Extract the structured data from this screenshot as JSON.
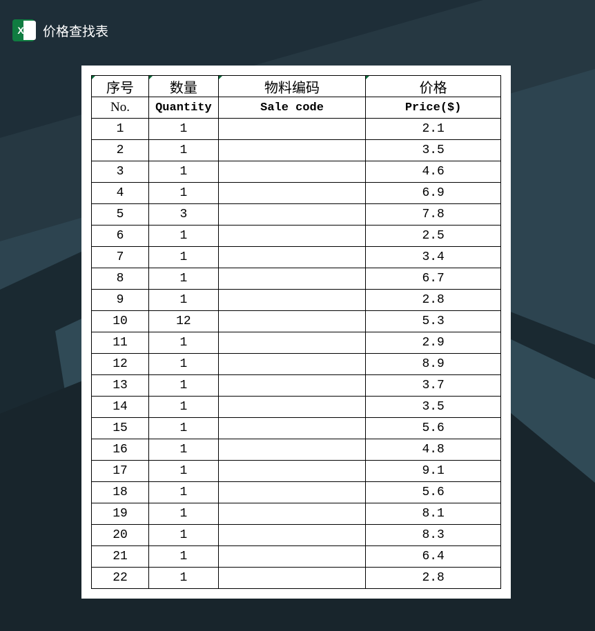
{
  "header": {
    "icon_letter": "X",
    "title": "价格查找表"
  },
  "table": {
    "headers_cn": [
      "序号",
      "数量",
      "物料编码",
      "价格"
    ],
    "headers_en": [
      "No.",
      "Quantity",
      "Sale code",
      "Price($)"
    ],
    "rows": [
      {
        "no": "1",
        "qty": "1",
        "code": "",
        "price": "2.1"
      },
      {
        "no": "2",
        "qty": "1",
        "code": "",
        "price": "3.5"
      },
      {
        "no": "3",
        "qty": "1",
        "code": "",
        "price": "4.6"
      },
      {
        "no": "4",
        "qty": "1",
        "code": "",
        "price": "6.9"
      },
      {
        "no": "5",
        "qty": "3",
        "code": "",
        "price": "7.8"
      },
      {
        "no": "6",
        "qty": "1",
        "code": "",
        "price": "2.5"
      },
      {
        "no": "7",
        "qty": "1",
        "code": "",
        "price": "3.4"
      },
      {
        "no": "8",
        "qty": "1",
        "code": "",
        "price": "6.7"
      },
      {
        "no": "9",
        "qty": "1",
        "code": "",
        "price": "2.8"
      },
      {
        "no": "10",
        "qty": "12",
        "code": "",
        "price": "5.3"
      },
      {
        "no": "11",
        "qty": "1",
        "code": "",
        "price": "2.9"
      },
      {
        "no": "12",
        "qty": "1",
        "code": "",
        "price": "8.9"
      },
      {
        "no": "13",
        "qty": "1",
        "code": "",
        "price": "3.7"
      },
      {
        "no": "14",
        "qty": "1",
        "code": "",
        "price": "3.5"
      },
      {
        "no": "15",
        "qty": "1",
        "code": "",
        "price": "5.6"
      },
      {
        "no": "16",
        "qty": "1",
        "code": "",
        "price": "4.8"
      },
      {
        "no": "17",
        "qty": "1",
        "code": "",
        "price": "9.1"
      },
      {
        "no": "18",
        "qty": "1",
        "code": "",
        "price": "5.6"
      },
      {
        "no": "19",
        "qty": "1",
        "code": "",
        "price": "8.1"
      },
      {
        "no": "20",
        "qty": "1",
        "code": "",
        "price": "8.3"
      },
      {
        "no": "21",
        "qty": "1",
        "code": "",
        "price": "6.4"
      },
      {
        "no": "22",
        "qty": "1",
        "code": "",
        "price": "2.8"
      }
    ]
  }
}
